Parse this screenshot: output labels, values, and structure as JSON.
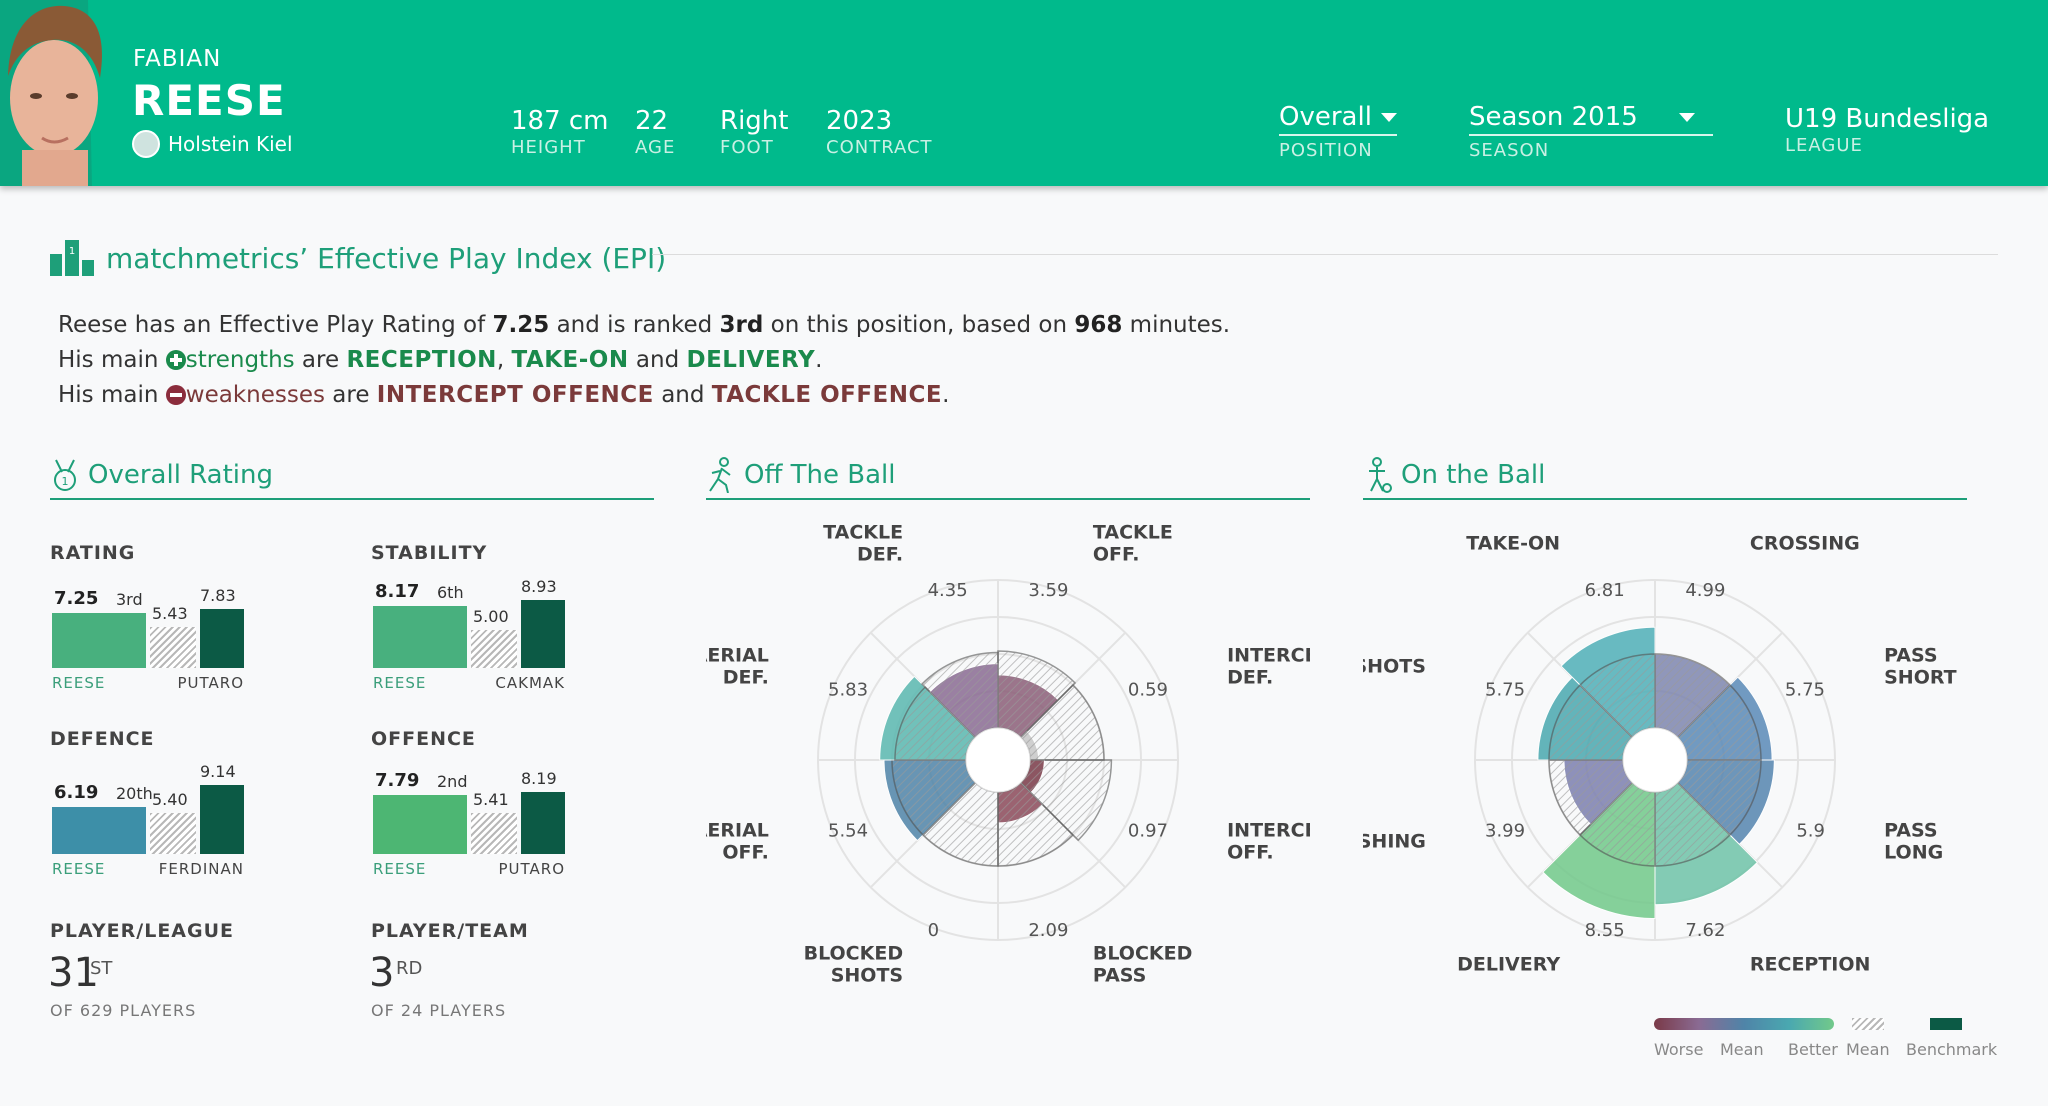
{
  "player": {
    "first_name": "FABIAN",
    "last_name": "REESE",
    "club": "Holstein Kiel"
  },
  "stats": [
    {
      "value": "187 cm",
      "label": "HEIGHT"
    },
    {
      "value": "22",
      "label": "AGE"
    },
    {
      "value": "Right",
      "label": "FOOT"
    },
    {
      "value": "2023",
      "label": "CONTRACT"
    }
  ],
  "filters": {
    "position": {
      "value": "Overall",
      "label": "POSITION"
    },
    "season": {
      "value": "Season 2015",
      "label": "SEASON"
    },
    "league": {
      "value": "U19 Bundesliga",
      "label": "LEAGUE"
    }
  },
  "epi": {
    "title": "matchmetrics’ Effective Play Index (EPI)",
    "line1": {
      "a": "Reese has an Effective Play Rating of ",
      "rating": "7.25",
      "b": " and is ranked ",
      "rank": "3rd",
      "c": " on this position, based on ",
      "minutes": "968",
      "d": " minutes."
    },
    "line2": {
      "a": "His main ",
      "word": "strengths",
      "b": " are ",
      "s1": "RECEPTION",
      "sep": ", ",
      "s2": "TAKE-ON",
      "and": " and ",
      "s3": "DELIVERY",
      "end": "."
    },
    "line3": {
      "a": "His main ",
      "word": "weaknesses",
      "b": " are ",
      "w1": "INTERCEPT OFFENCE",
      "and": " and ",
      "w2": "TACKLE OFFENCE",
      "end": "."
    }
  },
  "sections": {
    "overall": "Overall Rating",
    "off": "Off The Ball",
    "on": "On the Ball"
  },
  "ratings": [
    {
      "label": "RATING",
      "value": "7.25",
      "rank": "3rd",
      "mean": "5.43",
      "bench": "7.83",
      "player": "REESE",
      "bench_name": "PUTARO",
      "v": 7.25,
      "m": 5.43,
      "b": 7.83,
      "color": "#48b07e"
    },
    {
      "label": "STABILITY",
      "value": "8.17",
      "rank": "6th",
      "mean": "5.00",
      "bench": "8.93",
      "player": "REESE",
      "bench_name": "CAKMAK",
      "v": 8.17,
      "m": 5.0,
      "b": 8.93,
      "color": "#48b07e"
    },
    {
      "label": "DEFENCE",
      "value": "6.19",
      "rank": "20th",
      "mean": "5.40",
      "bench": "9.14",
      "player": "REESE",
      "bench_name": "FERDINAN",
      "v": 6.19,
      "m": 5.4,
      "b": 9.14,
      "color": "#3d8fa8"
    },
    {
      "label": "OFFENCE",
      "value": "7.79",
      "rank": "2nd",
      "mean": "5.41",
      "bench": "8.19",
      "player": "REESE",
      "bench_name": "PUTARO",
      "v": 7.79,
      "m": 5.41,
      "b": 8.19,
      "color": "#4db673"
    }
  ],
  "ranks": [
    {
      "label": "PLAYER/LEAGUE",
      "num": "31",
      "sup": "ST",
      "of": "OF 629 PLAYERS"
    },
    {
      "label": "PLAYER/TEAM",
      "num": "3",
      "sup": "RD",
      "of": "OF 24 PLAYERS"
    }
  ],
  "off_ball": [
    {
      "label": [
        "TACKLE",
        "OFF."
      ],
      "value": "3.59",
      "v": 3.59,
      "mean": 5.2,
      "color": "#8b5f78"
    },
    {
      "label": [
        "INTERCEPT",
        "DEF."
      ],
      "value": "0.59",
      "v": 0.59,
      "mean": 5.0,
      "color": "#c8c8c8"
    },
    {
      "label": [
        "INTERCEPT",
        "OFF."
      ],
      "value": "0.97",
      "v": 0.97,
      "mean": 5.5,
      "color": "#7a3a48"
    },
    {
      "label": [
        "BLOCKED",
        "PASS"
      ],
      "value": "2.09",
      "v": 2.09,
      "mean": 5.0,
      "color": "#8b4a5a"
    },
    {
      "label": [
        "BLOCKED",
        "SHOTS"
      ],
      "value": "0",
      "v": 0.0,
      "mean": 5.0,
      "color": "#c8c8c8"
    },
    {
      "label": [
        "AERIAL",
        "OFF."
      ],
      "value": "5.54",
      "v": 5.54,
      "mean": 5.0,
      "color": "#4f84a8"
    },
    {
      "label": [
        "AERIAL",
        "DEF."
      ],
      "value": "5.83",
      "v": 5.83,
      "mean": 4.8,
      "color": "#5ab8b0"
    },
    {
      "label": [
        "TACKLE",
        "DEF."
      ],
      "value": "4.35",
      "v": 4.35,
      "mean": 5.1,
      "color": "#8a6b93"
    }
  ],
  "on_ball": [
    {
      "label": [
        "CROSSING"
      ],
      "value": "4.99",
      "v": 4.99,
      "mean": 5.0,
      "color": "#7e86b0"
    },
    {
      "label": [
        "PASS",
        "SHORT"
      ],
      "value": "5.75",
      "v": 5.75,
      "mean": 5.0,
      "color": "#5a8ab8"
    },
    {
      "label": [
        "PASS",
        "LONG"
      ],
      "value": "5.9",
      "v": 5.9,
      "mean": 5.0,
      "color": "#5585b0"
    },
    {
      "label": [
        "RECEPTION"
      ],
      "value": "7.62",
      "v": 7.62,
      "mean": 5.0,
      "color": "#6fc4a8"
    },
    {
      "label": [
        "DELIVERY"
      ],
      "value": "8.55",
      "v": 8.55,
      "mean": 5.0,
      "color": "#72c98a"
    },
    {
      "label": [
        "FINISHING"
      ],
      "value": "3.99",
      "v": 3.99,
      "mean": 5.0,
      "color": "#7c80b0"
    },
    {
      "label": [
        "SHOTS"
      ],
      "value": "5.75",
      "v": 5.75,
      "mean": 5.0,
      "color": "#4aa8b0"
    },
    {
      "label": [
        "TAKE-ON"
      ],
      "value": "6.81",
      "v": 6.81,
      "mean": 5.0,
      "color": "#50b0b8"
    }
  ],
  "legend": {
    "worse": "Worse",
    "mean": "Mean",
    "better": "Better",
    "mean2": "Mean",
    "bench": "Benchmark"
  }
}
